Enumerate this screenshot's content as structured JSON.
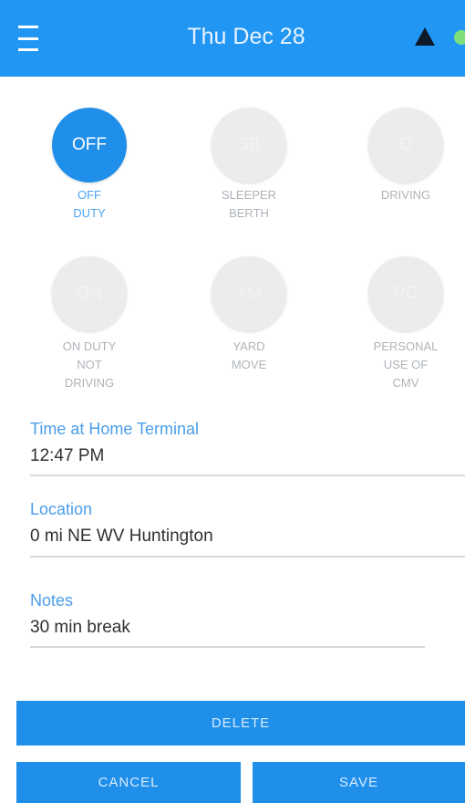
{
  "header": {
    "menu_icon": "menu-icon",
    "title": "Thu Dec 28",
    "warning_icon": "warning-icon",
    "status_indicator_color": "#7ee07a"
  },
  "duty_statuses": [
    {
      "code": "OFF",
      "label_line1": "OFF",
      "label_line2": "DUTY",
      "label_line3": "",
      "active": true
    },
    {
      "code": "SB",
      "label_line1": "SLEEPER",
      "label_line2": "BERTH",
      "label_line3": "",
      "active": false
    },
    {
      "code": "D",
      "label_line1": "DRIVING",
      "label_line2": "",
      "label_line3": "",
      "active": false
    },
    {
      "code": "ON",
      "label_line1": "ON DUTY",
      "label_line2": "NOT",
      "label_line3": "DRIVING",
      "active": false
    },
    {
      "code": "YM",
      "label_line1": "YARD",
      "label_line2": "MOVE",
      "label_line3": "",
      "active": false
    },
    {
      "code": "PC",
      "label_line1": "PERSONAL",
      "label_line2": "USE OF",
      "label_line3": "CMV",
      "active": false
    }
  ],
  "form": {
    "time_label": "Time at Home Terminal",
    "time_value": "12:47 PM",
    "location_label": "Location",
    "location_value": "0 mi NE WV Huntington",
    "notes_label": "Notes",
    "notes_value": "30 min break"
  },
  "actions": {
    "delete_label": "DELETE",
    "cancel_label": "CANCEL",
    "save_label": "SAVE"
  },
  "colors": {
    "primary": "#2196f3",
    "active_status": "#1f8fea",
    "inactive_status": "#ececec",
    "field_label": "#4a9eea"
  }
}
